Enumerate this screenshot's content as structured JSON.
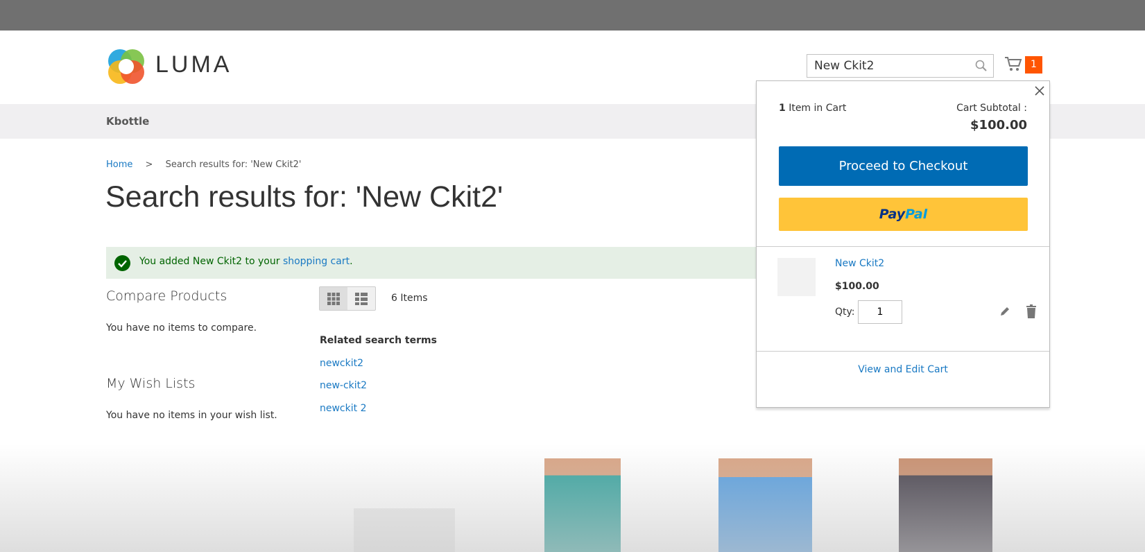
{
  "header": {
    "logo": "LUMA",
    "search_value": "New Ckit2",
    "cart_count": "1"
  },
  "nav": {
    "items": [
      {
        "label": "Kbottle"
      }
    ]
  },
  "breadcrumb": {
    "home": "Home",
    "separator": ">",
    "current": "Search results for: 'New Ckit2'"
  },
  "page_title": "Search results for: 'New Ckit2'",
  "message": {
    "prefix": "You added New Ckit2 to your ",
    "link": "shopping cart",
    "suffix": "."
  },
  "sidebar": {
    "compare_title": "Compare Products",
    "compare_empty": "You have no items to compare.",
    "wishlist_title": "My Wish Lists",
    "wishlist_empty": "You have no items in your wish list."
  },
  "toolbar": {
    "count": "6 Items",
    "modes": [
      "grid",
      "list"
    ]
  },
  "related": {
    "title": "Related search terms",
    "terms": [
      "newckit2",
      "new-ckit2",
      "newckit 2"
    ]
  },
  "minicart": {
    "count": "1",
    "count_label": "Item in Cart",
    "subtotal_label": "Cart Subtotal :",
    "subtotal": "$100.00",
    "checkout_label": "Proceed to Checkout",
    "paypal_a": "Pay",
    "paypal_b": "Pal",
    "item": {
      "name": "New Ckit2",
      "price": "$100.00",
      "qty_label": "Qty:",
      "qty": "1"
    },
    "view_edit": "View and Edit Cart"
  },
  "colors": {
    "accent": "#1979c3",
    "checkout": "#006bb4",
    "paypal": "#ffc439",
    "badge": "#ff5501",
    "success_bg": "#e5efe5"
  }
}
